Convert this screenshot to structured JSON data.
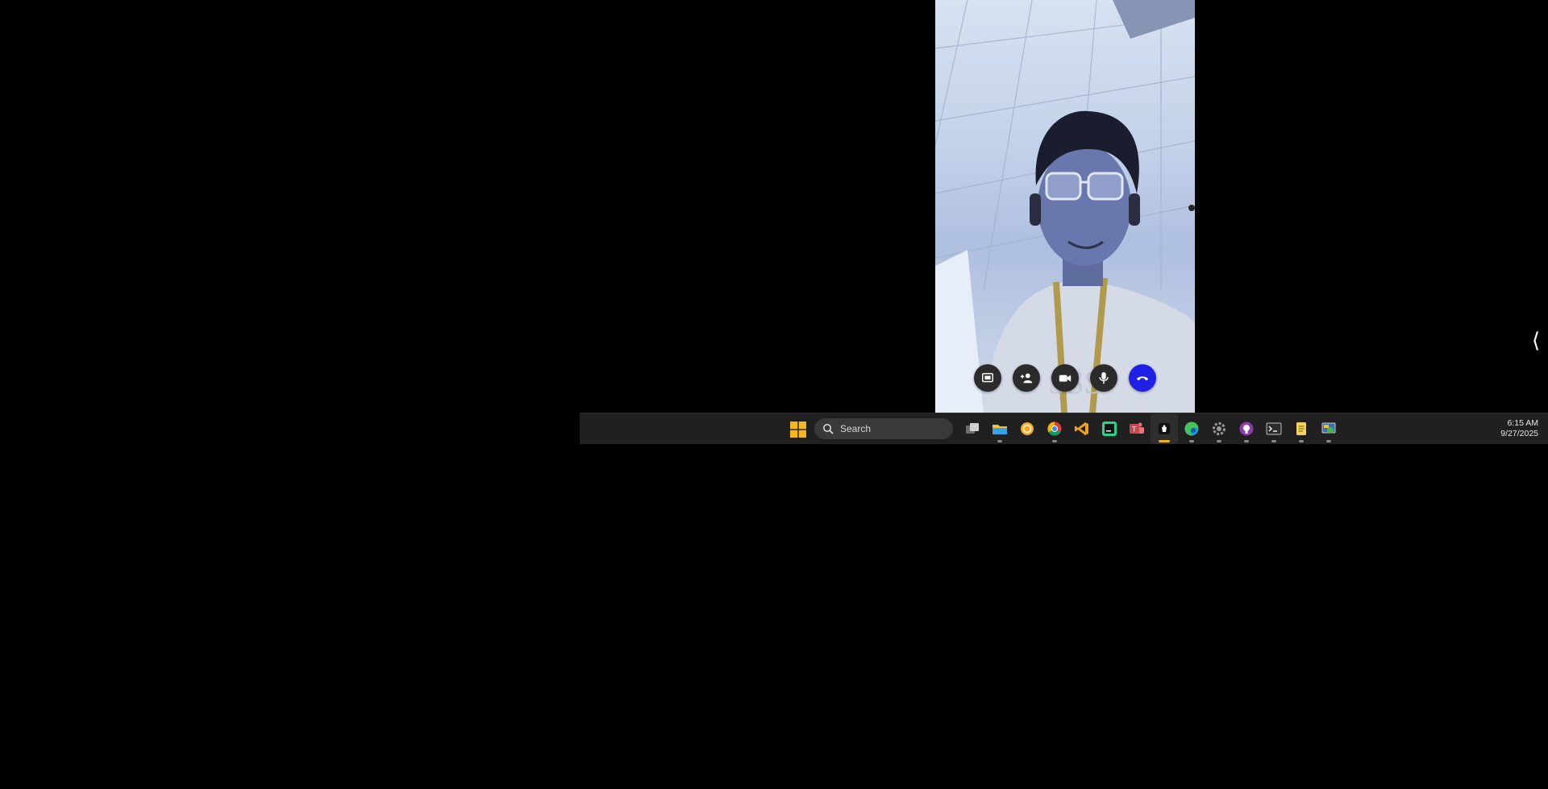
{
  "call": {
    "shirt_text": "SSS",
    "controls": [
      {
        "name": "share-screen-button",
        "icon": "cast-icon"
      },
      {
        "name": "add-person-button",
        "icon": "add-person-icon"
      },
      {
        "name": "camera-button",
        "icon": "video-camera-icon"
      },
      {
        "name": "microphone-button",
        "icon": "microphone-icon"
      },
      {
        "name": "end-call-button",
        "icon": "phone-hangup-icon",
        "color": "#1f1fe6"
      }
    ]
  },
  "side_chevron": "⟨",
  "taskbar": {
    "search_label": "Search",
    "apps": [
      {
        "name": "task-view",
        "icon": "task-view-icon",
        "running": false
      },
      {
        "name": "file-explorer",
        "icon": "folder-icon",
        "running": true
      },
      {
        "name": "app-orange",
        "icon": "coin-icon",
        "running": false
      },
      {
        "name": "chrome",
        "icon": "chrome-icon",
        "running": true
      },
      {
        "name": "vs-code",
        "icon": "vscode-icon",
        "running": false
      },
      {
        "name": "pycharm",
        "icon": "pycharm-icon",
        "running": false
      },
      {
        "name": "teams",
        "icon": "teams-icon",
        "running": false
      },
      {
        "name": "video-call-app",
        "icon": "video-app-icon",
        "running": true,
        "active": true
      },
      {
        "name": "edge",
        "icon": "edge-icon",
        "running": true
      },
      {
        "name": "settings",
        "icon": "gear-icon",
        "running": true
      },
      {
        "name": "github-desktop",
        "icon": "github-icon",
        "running": true
      },
      {
        "name": "terminal",
        "icon": "terminal-icon",
        "running": true
      },
      {
        "name": "notepad",
        "icon": "notepad-icon",
        "running": true
      },
      {
        "name": "control-panel",
        "icon": "control-panel-icon",
        "running": true
      }
    ],
    "clock": {
      "time": "6:15 AM",
      "date": "9/27/2025"
    }
  },
  "colors": {
    "taskbar_bg": "#202020",
    "end_call": "#1f1fe6",
    "active_indicator": "#e8b21c"
  }
}
